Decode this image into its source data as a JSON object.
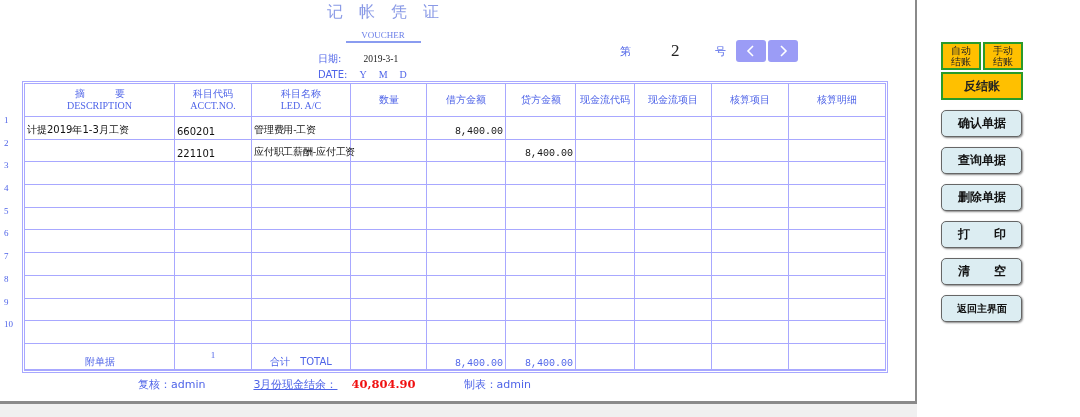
{
  "title": "记　帐　凭　证",
  "subtitle": "VOUCHER",
  "date": {
    "label": "日期:",
    "value": "2019-3-1",
    "label_en": "DATE:",
    "parts": [
      "Y",
      "M",
      "D"
    ]
  },
  "number": {
    "prefix": "第",
    "value": "2",
    "suffix": "号"
  },
  "columns": [
    {
      "cn": "摘　　　要",
      "en": "DESCRIPTION"
    },
    {
      "cn": "科目代码",
      "en": "ACCT.NO."
    },
    {
      "cn": "科目名称",
      "en": "LED. A/C"
    },
    {
      "cn": "数量"
    },
    {
      "cn": "借方金额"
    },
    {
      "cn": "贷方金额"
    },
    {
      "cn": "现金流代码"
    },
    {
      "cn": "现金流项目"
    },
    {
      "cn": "核算项目"
    },
    {
      "cn": "核算明细"
    }
  ],
  "rows": [
    {
      "number": "1",
      "description": "计提2019年1-3月工资",
      "acct_no": "660201",
      "account_name": "管理费用-工资",
      "debit": "8,400.00"
    },
    {
      "number": "2",
      "acct_no": "221101",
      "account_name": "应付职工薪酬-应付工资",
      "credit": "8,400.00"
    },
    {
      "number": "3"
    },
    {
      "number": "4"
    },
    {
      "number": "5"
    },
    {
      "number": "6"
    },
    {
      "number": "7"
    },
    {
      "number": "8"
    },
    {
      "number": "9"
    },
    {
      "number": "10"
    }
  ],
  "total": {
    "attachments_label": "附单据",
    "attachments": "1",
    "label": "合计　TOTAL",
    "debit": "8,400.00",
    "credit": "8,400.00"
  },
  "footer": {
    "reviewer": "复核：admin",
    "balance_label": "3月份现金结余：",
    "balance": "40,804.90",
    "maker": "制表：admin"
  },
  "close_buttons": [
    {
      "lines": [
        "自动",
        "结账"
      ]
    },
    {
      "lines": [
        "手动",
        "结账"
      ]
    }
  ],
  "reverse_button": "反结账",
  "actions": [
    "确认单据",
    "查询单据",
    "删除单据",
    "打　　印",
    "清　　空",
    "返回主界面"
  ]
}
